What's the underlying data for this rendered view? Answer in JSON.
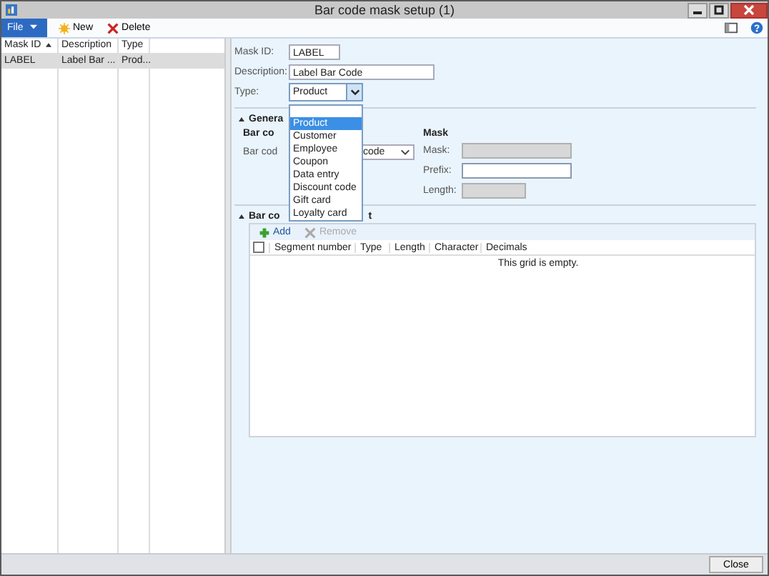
{
  "window": {
    "title": "Bar code mask setup (1)"
  },
  "toolbar": {
    "file": "File",
    "actions": [
      {
        "label": "New",
        "kind": "new"
      },
      {
        "label": "Delete",
        "kind": "delete"
      }
    ]
  },
  "list": {
    "columns": [
      {
        "label": "Mask ID",
        "sorted": true
      },
      {
        "label": "Description",
        "sorted": false
      },
      {
        "label": "Type",
        "sorted": false
      }
    ],
    "rows": [
      {
        "cells": [
          "LABEL",
          "Label Bar ...",
          "Prod..."
        ],
        "selected": true
      }
    ]
  },
  "form": {
    "fields": [
      {
        "label": "Mask ID:",
        "value": "LABEL"
      },
      {
        "label": "Description:",
        "value": "Label Bar Code"
      }
    ],
    "type": {
      "label": "Type:",
      "value": "Product",
      "expanded": true,
      "options": [
        {
          "label": "Product",
          "selected": true
        },
        {
          "label": "Customer",
          "selected": false
        },
        {
          "label": "Employee",
          "selected": false
        },
        {
          "label": "Coupon",
          "selected": false
        },
        {
          "label": "Data entry",
          "selected": false
        },
        {
          "label": "Discount code",
          "selected": false
        },
        {
          "label": "Gift card",
          "selected": false
        },
        {
          "label": "Loyalty card",
          "selected": false
        }
      ]
    }
  },
  "general": {
    "heading": "Genera",
    "expanded": true,
    "group_heading": "Bar co",
    "field_label": "Bar cod",
    "field_value": "code",
    "mask": {
      "heading": "Mask",
      "fields": [
        {
          "label": "Mask:",
          "disabled": true
        },
        {
          "label": "Prefix:",
          "disabled": false
        },
        {
          "label": "Length:",
          "disabled": true
        }
      ]
    }
  },
  "segments": {
    "heading": "Bar co",
    "heading_tail": "t",
    "expanded": true,
    "actions": [
      {
        "label": "Add",
        "disabled": false
      },
      {
        "label": "Remove",
        "disabled": true
      }
    ],
    "all_checked": false,
    "columns": [
      "Segment number",
      "Type",
      "Length",
      "Character",
      "Decimals"
    ],
    "empty_text": "This grid is empty."
  },
  "footer": {
    "buttons": [
      "Close"
    ]
  }
}
